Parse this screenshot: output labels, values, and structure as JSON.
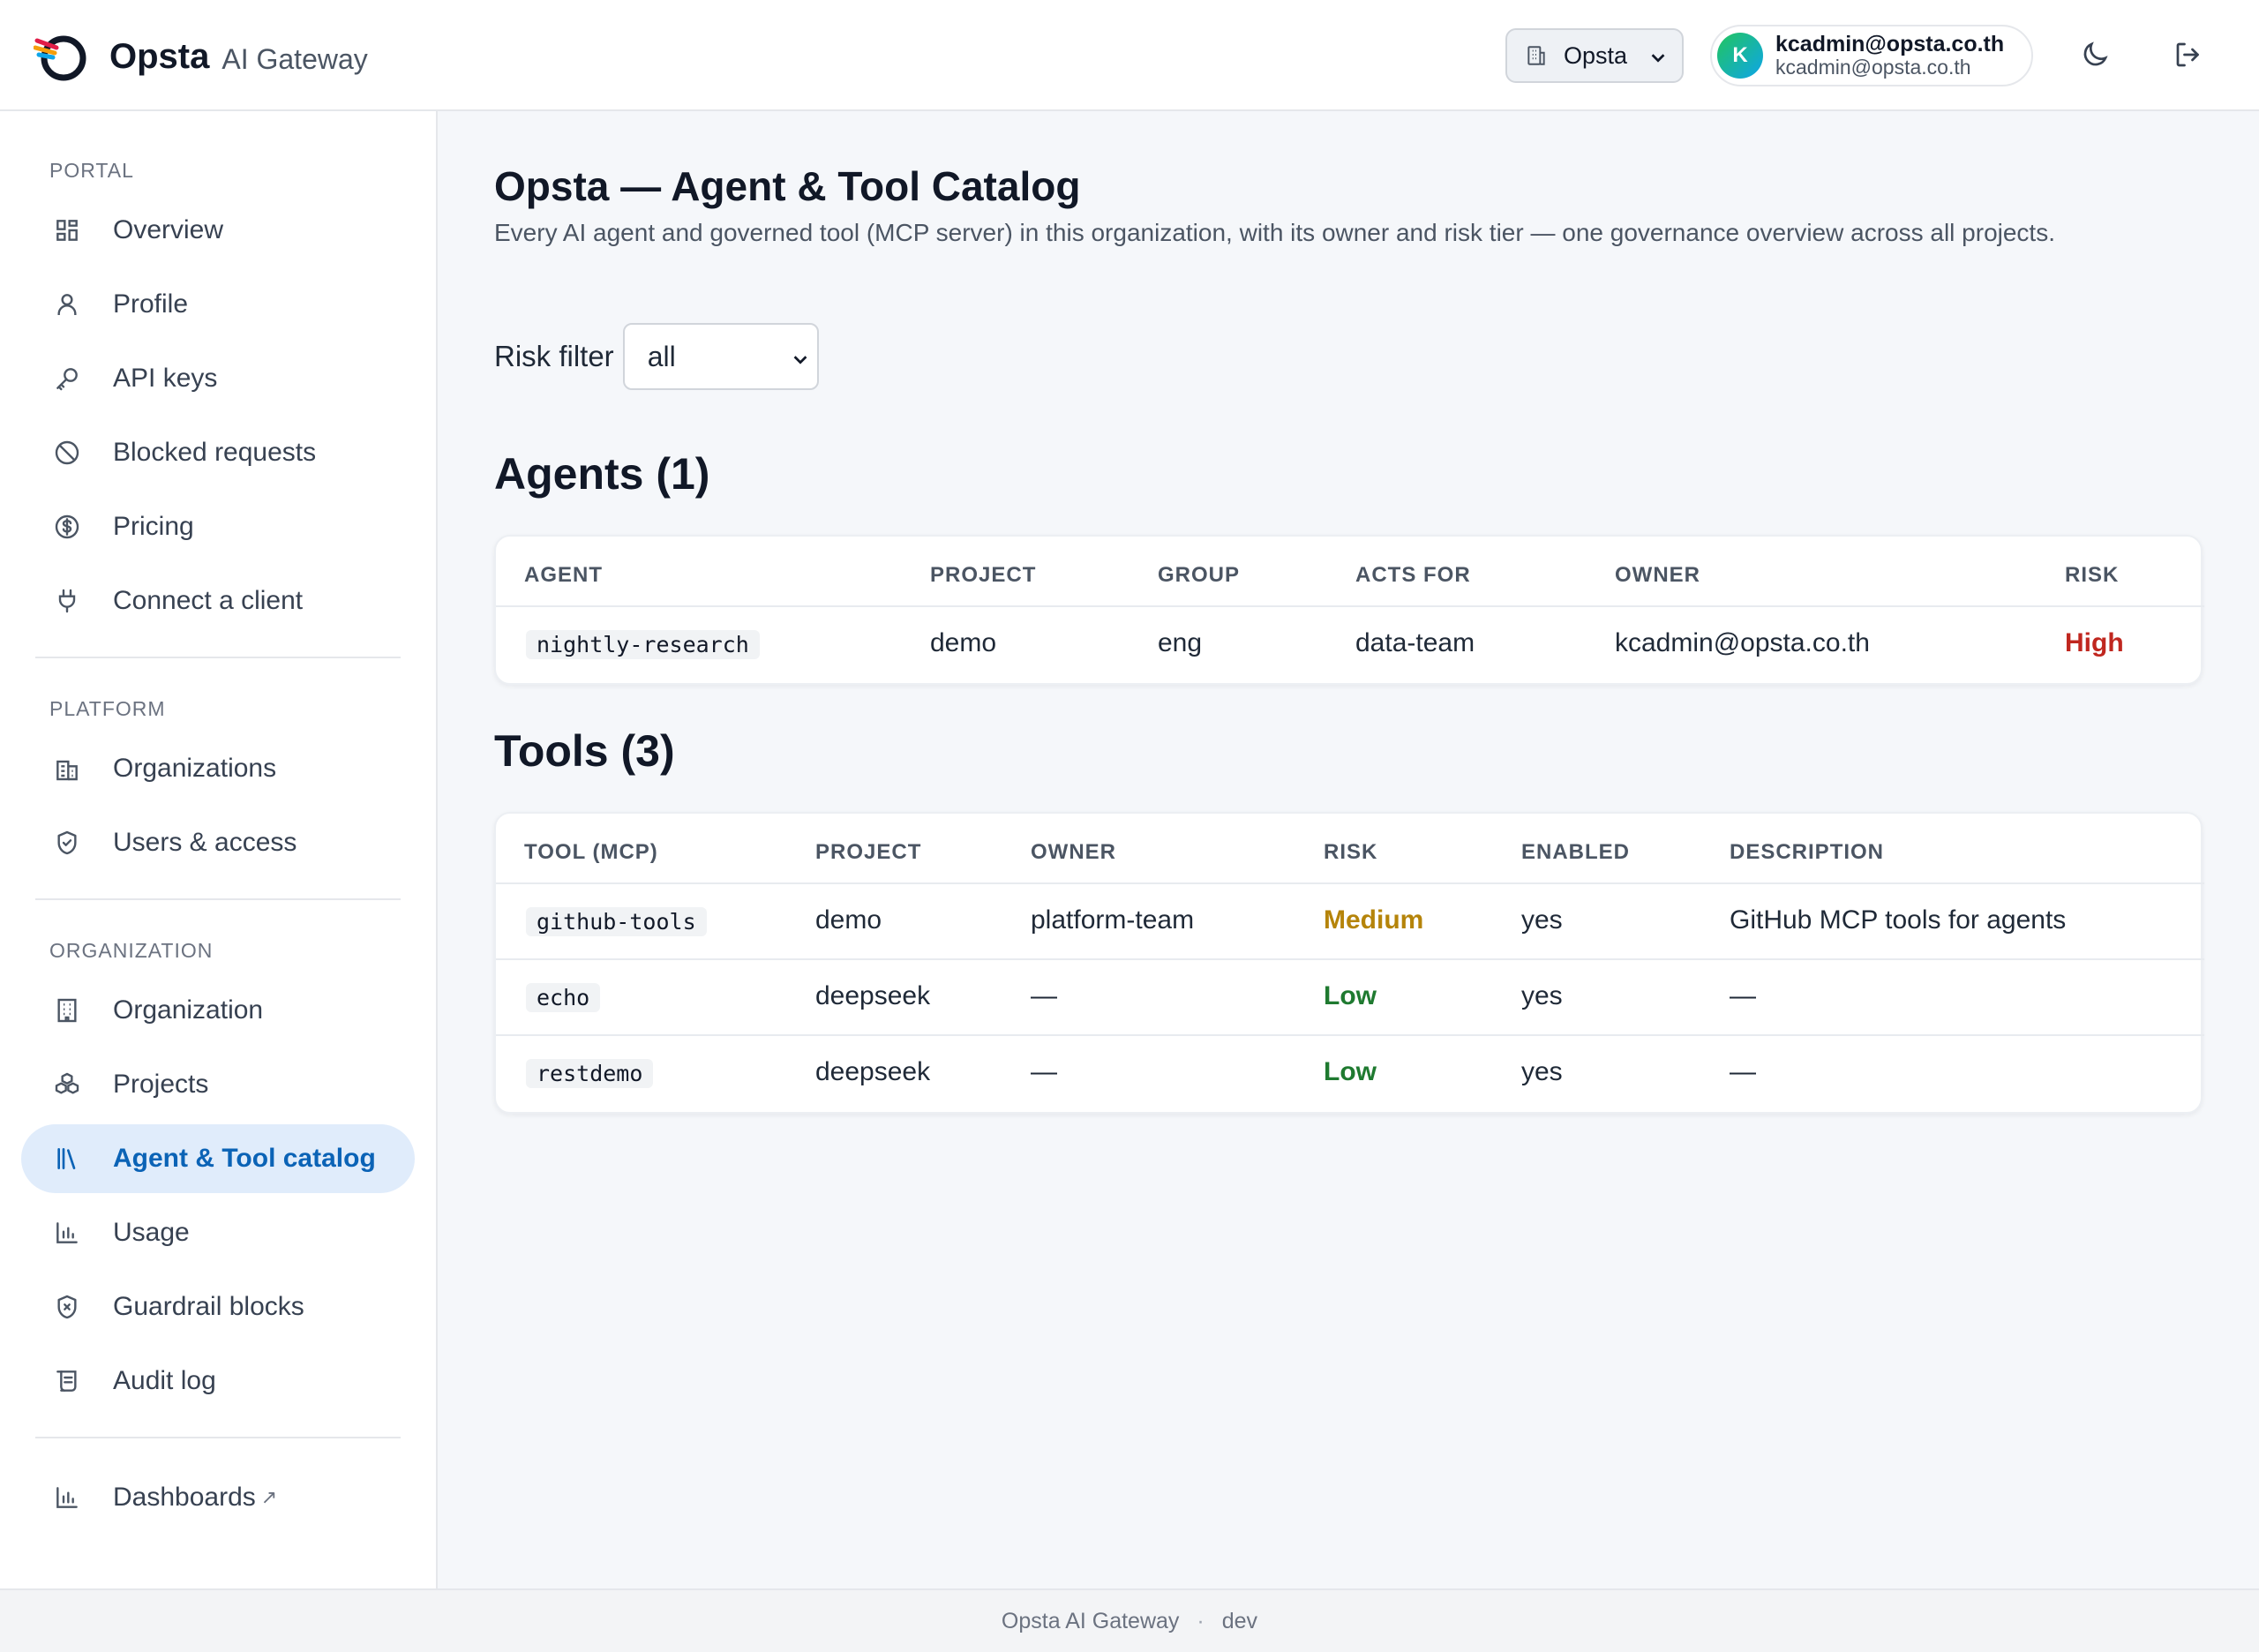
{
  "header": {
    "brand_name": "Opsta",
    "brand_sub": "AI Gateway",
    "org_select_value": "Opsta",
    "user": {
      "initial": "K",
      "name": "kcadmin@opsta.co.th",
      "email": "kcadmin@opsta.co.th"
    },
    "icons": [
      "building-icon",
      "chevron-down-icon",
      "moon-icon",
      "logout-icon"
    ]
  },
  "sidebar": {
    "portal_title": "PORTAL",
    "portal_items": [
      {
        "label": "Overview",
        "icon": "grid-icon"
      },
      {
        "label": "Profile",
        "icon": "user-icon"
      },
      {
        "label": "API keys",
        "icon": "key-icon"
      },
      {
        "label": "Blocked requests",
        "icon": "ban-icon"
      },
      {
        "label": "Pricing",
        "icon": "dollar-icon"
      },
      {
        "label": "Connect a client",
        "icon": "plug-icon"
      }
    ],
    "platform_title": "PLATFORM",
    "platform_items": [
      {
        "label": "Organizations",
        "icon": "buildings-icon"
      },
      {
        "label": "Users & access",
        "icon": "shield-check-icon"
      }
    ],
    "organization_title": "ORGANIZATION",
    "organization_items": [
      {
        "label": "Organization",
        "icon": "building-icon"
      },
      {
        "label": "Projects",
        "icon": "boxes-icon"
      },
      {
        "label": "Agent & Tool catalog",
        "icon": "library-icon",
        "active": true
      },
      {
        "label": "Usage",
        "icon": "bar-chart-icon"
      },
      {
        "label": "Guardrail blocks",
        "icon": "shield-x-icon"
      },
      {
        "label": "Audit log",
        "icon": "scroll-icon"
      }
    ],
    "dashboards": {
      "label": "Dashboards",
      "external_mark": "↗",
      "icon": "bar-chart-icon"
    }
  },
  "main": {
    "title": "Opsta — Agent & Tool Catalog",
    "description": "Every AI agent and governed tool (MCP server) in this organization, with its owner and risk tier — one governance overview across all projects.",
    "filter_label": "Risk filter",
    "filter_value": "all",
    "agents_heading": "Agents (1)",
    "agents_columns": [
      "AGENT",
      "PROJECT",
      "GROUP",
      "ACTS FOR",
      "OWNER",
      "RISK"
    ],
    "agents": [
      {
        "agent": "nightly-research",
        "project": "demo",
        "group": "eng",
        "acts_for": "data-team",
        "owner": "kcadmin@opsta.co.th",
        "risk": "High"
      }
    ],
    "tools_heading": "Tools (3)",
    "tools_columns": [
      "TOOL (MCP)",
      "PROJECT",
      "OWNER",
      "RISK",
      "ENABLED",
      "DESCRIPTION"
    ],
    "tools": [
      {
        "tool": "github-tools",
        "project": "demo",
        "owner": "platform-team",
        "risk": "Medium",
        "enabled": "yes",
        "description": "GitHub MCP tools for agents"
      },
      {
        "tool": "echo",
        "project": "deepseek",
        "owner": "—",
        "risk": "Low",
        "enabled": "yes",
        "description": "—"
      },
      {
        "tool": "restdemo",
        "project": "deepseek",
        "owner": "—",
        "risk": "Low",
        "enabled": "yes",
        "description": "—"
      }
    ],
    "risk_colors": {
      "High": "#c0271f",
      "Medium": "#b5840a",
      "Low": "#1f7a30"
    }
  },
  "footer": {
    "product": "Opsta AI Gateway",
    "separator": "·",
    "env": "dev"
  }
}
